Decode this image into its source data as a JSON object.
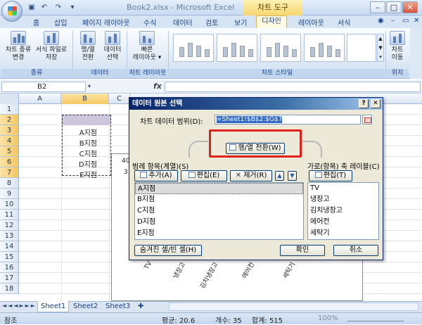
{
  "window": {
    "title": "Book2.xlsx - Microsoft Excel",
    "chart_tools": "차트 도구",
    "min": "–",
    "max": "□",
    "close": "✕"
  },
  "ribbon": {
    "tabs": [
      "홈",
      "삽입",
      "페이지 레이아웃",
      "수식",
      "데이터",
      "검토",
      "보기",
      "디자인",
      "레이아웃",
      "서식"
    ],
    "groups": {
      "type_label": "종류",
      "data_label": "데이터",
      "layout_label": "차트 레이아웃",
      "style_label": "차트 스타일",
      "location_label": "위치"
    },
    "buttons": {
      "change_type": [
        "차트 종류",
        "변경"
      ],
      "save_template": [
        "서식 파일로",
        "저장"
      ],
      "switch_rowcol": [
        "행/열",
        "전환"
      ],
      "select_data": [
        "데이터",
        "선택"
      ],
      "quick_layout": [
        "빠른",
        "레이아웃 ▾"
      ],
      "move_chart": [
        "차트",
        "이동"
      ]
    }
  },
  "formula_bar": {
    "name_box": "B2",
    "fx": "fx"
  },
  "sheet": {
    "columns": [
      "A",
      "B",
      "C"
    ],
    "rows": [
      "1",
      "2",
      "3",
      "4",
      "5",
      "6",
      "7",
      "8",
      "9",
      "10",
      "11",
      "12",
      "13",
      "14",
      "15",
      "16",
      "17",
      "18"
    ],
    "b_values": [
      "A지점",
      "B지점",
      "C지점",
      "D지점",
      "E지점"
    ],
    "chart_y_values": [
      "40",
      "3"
    ],
    "chart_categories": [
      "TV",
      "냉장고",
      "김치냉장고",
      "에어컨",
      "세탁기"
    ]
  },
  "sheet_tabs": [
    "Sheet1",
    "Sheet2",
    "Sheet3"
  ],
  "status": {
    "mode": "참조",
    "average": "평균: 20.6",
    "count": "개수: 35",
    "sum": "합계: 515",
    "zoom": "100%"
  },
  "dialog": {
    "title": "데이터 원본 선택",
    "help": "?",
    "close": "✕",
    "range_label": "차트 데이터 범위(D):",
    "range_value": "=Sheet1!$B$2:$G$7",
    "switch_button": "행/열 전환(W)",
    "legend_label": "범례 항목(계열)(S)",
    "add_button": "추가(A)",
    "edit_button": "편집(E)",
    "remove_button": "제거(R)",
    "legend_items": [
      "A지점",
      "B지점",
      "C지점",
      "D지점",
      "E지점"
    ],
    "axis_label": "가로(항목) 축 레이블(C)",
    "axis_edit_button": "편집(T)",
    "axis_items": [
      "TV",
      "냉장고",
      "김치냉장고",
      "에어컨",
      "세탁기"
    ],
    "hidden_cells_button": "숨겨진 셀/빈 셀(H)",
    "ok_button": "확인",
    "cancel_button": "취소",
    "highlight_color": "#e0201a"
  }
}
